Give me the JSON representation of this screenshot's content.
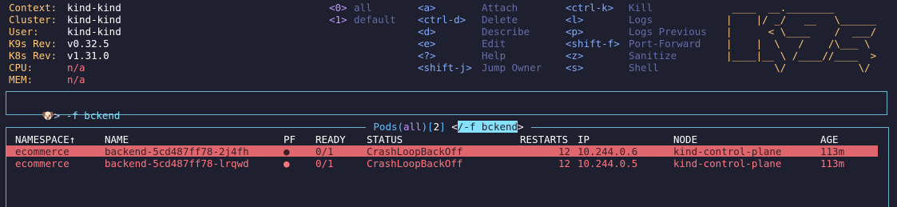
{
  "info": {
    "context_label": "Context:",
    "context_value": "kind-kind",
    "cluster_label": "Cluster:",
    "cluster_value": "kind-kind",
    "user_label": "User:",
    "user_value": "kind-kind",
    "k9s_label": "K9s Rev:",
    "k9s_value": "v0.32.5",
    "k8s_label": "K8s Rev:",
    "k8s_value": "v1.31.0",
    "cpu_label": "CPU:",
    "cpu_value": "n/a",
    "mem_label": "MEM:",
    "mem_value": "n/a"
  },
  "namespaces": [
    {
      "key": "<0>",
      "label": "all"
    },
    {
      "key": "<1>",
      "label": "default"
    }
  ],
  "hotkeys_col1": [
    {
      "key": "<a>",
      "label": "Attach"
    },
    {
      "key": "<ctrl-d>",
      "label": "Delete"
    },
    {
      "key": "<d>",
      "label": "Describe"
    },
    {
      "key": "<e>",
      "label": "Edit"
    },
    {
      "key": "<?>",
      "label": "Help"
    },
    {
      "key": "<shift-j>",
      "label": "Jump Owner"
    }
  ],
  "hotkeys_col2": [
    {
      "key": "<ctrl-k>",
      "label": "Kill"
    },
    {
      "key": "<l>",
      "label": "Logs"
    },
    {
      "key": "<p>",
      "label": "Logs Previous"
    },
    {
      "key": "<shift-f>",
      "label": "Port-Forward"
    },
    {
      "key": "<z>",
      "label": "Sanitize"
    },
    {
      "key": "<s>",
      "label": "Shell"
    }
  ],
  "logo_lines": [
    " ____  __.________        ",
    "|    |/ _/   __   \\______ ",
    "|      < \\____    /  ___/ ",
    "|    |  \\   /    /\\___ \\  ",
    "|____|__ \\ /____//____  > ",
    "        \\/            \\/  "
  ],
  "filter": {
    "icon": "🐶>",
    "text": " -f bckend"
  },
  "table_title": {
    "resource": " Pods(",
    "scope": "all",
    "close": ")[",
    "count": "2",
    "close2": "] ",
    "filter_open": "<",
    "filter": "/-f bckend",
    "filter_close": ">",
    "end": " "
  },
  "columns": [
    "NAMESPACE↑",
    "NAME",
    "PF",
    "READY",
    "STATUS",
    "RESTARTS",
    "IP",
    "NODE",
    "AGE"
  ],
  "rows": [
    {
      "namespace": "ecommerce",
      "name": "backend-5cd487ff78-2j4fh",
      "pf": "●",
      "ready": "0/1",
      "status": "CrashLoopBackOff",
      "restarts": "12",
      "ip": "10.244.0.6",
      "node": "kind-control-plane",
      "age": "113m"
    },
    {
      "namespace": "ecommerce",
      "name": "backend-5cd487ff78-lrqwd",
      "pf": "●",
      "ready": "0/1",
      "status": "CrashLoopBackOff",
      "restarts": "12",
      "ip": "10.244.0.5",
      "node": "kind-control-plane",
      "age": "113m"
    }
  ]
}
